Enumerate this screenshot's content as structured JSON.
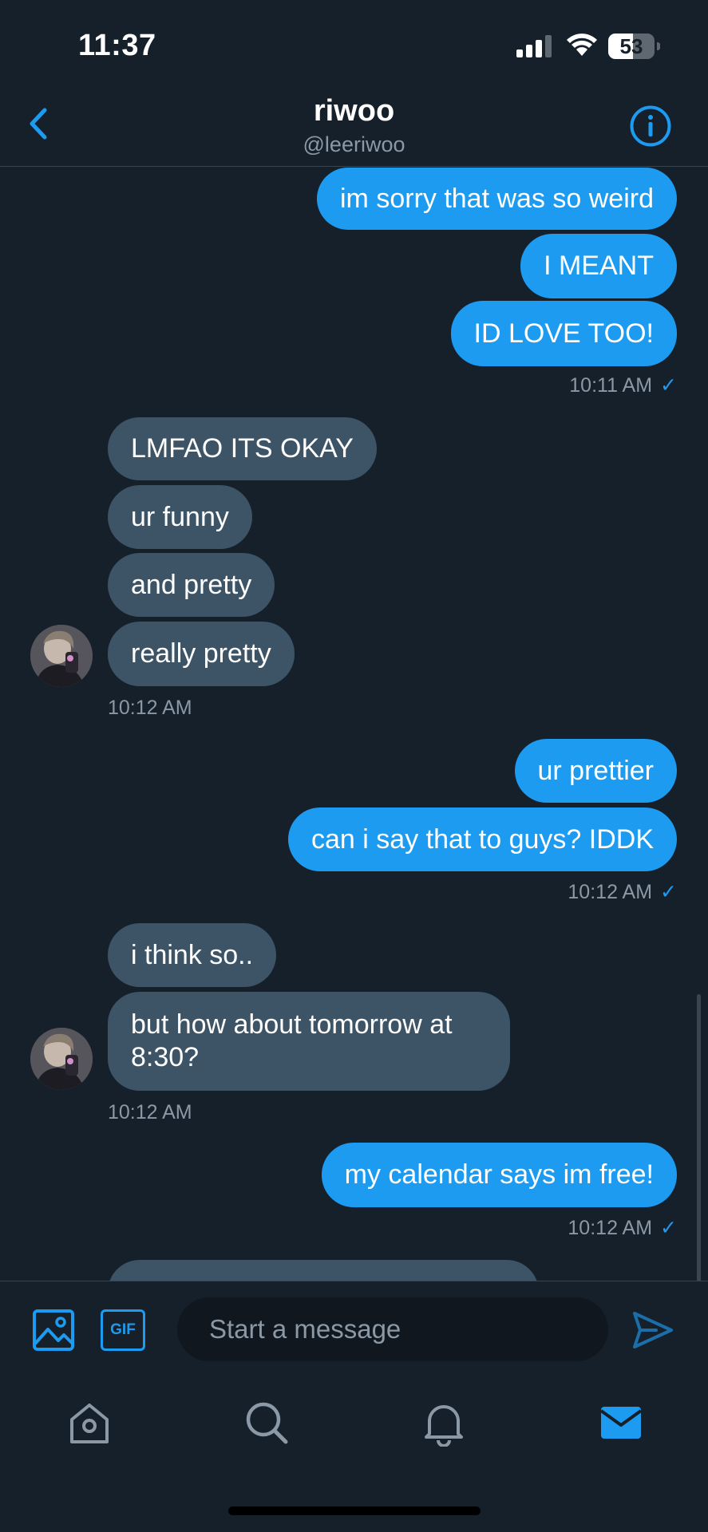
{
  "status_bar": {
    "time": "11:37",
    "battery_percent": "53",
    "battery_level": 0.53,
    "signal_icon": "cellular-signal-icon",
    "wifi_icon": "wifi-icon"
  },
  "header": {
    "name": "riwoo",
    "handle": "@leeriwoo",
    "back_icon": "chevron-left-icon",
    "info_icon": "info-circle-icon"
  },
  "messages": [
    {
      "side": "sent",
      "text": "im sorry that was so weird"
    },
    {
      "side": "sent",
      "text": "I MEANT"
    },
    {
      "side": "sent",
      "text": "ID LOVE TOO!"
    },
    {
      "side": "sent-time",
      "text": "10:11 AM",
      "check": "✓"
    },
    {
      "side": "received",
      "text": "LMFAO ITS OKAY"
    },
    {
      "side": "received",
      "text": "ur funny"
    },
    {
      "side": "received",
      "text": "and pretty"
    },
    {
      "side": "received",
      "text": "really pretty"
    },
    {
      "side": "received-time",
      "text": "10:12 AM"
    },
    {
      "side": "sent",
      "text": "ur prettier"
    },
    {
      "side": "sent",
      "text": "can i say that to guys? IDDK"
    },
    {
      "side": "sent-time",
      "text": "10:12 AM",
      "check": "✓"
    },
    {
      "side": "received",
      "text": "i think so.."
    },
    {
      "side": "received",
      "text": "but how about tomorrow at 8:30?"
    },
    {
      "side": "received-time",
      "text": "10:12 AM"
    },
    {
      "side": "sent",
      "text": "my calendar says im free!"
    },
    {
      "side": "sent-time",
      "text": "10:12 AM",
      "check": "✓"
    }
  ],
  "composer": {
    "placeholder": "Start a message",
    "gif_label": "GIF",
    "media_icon": "image-icon",
    "send_icon": "send-icon"
  },
  "tabs": [
    {
      "name": "home",
      "icon": "home-icon",
      "active": false
    },
    {
      "name": "search",
      "icon": "search-icon",
      "active": false
    },
    {
      "name": "notifications",
      "icon": "bell-icon",
      "active": false
    },
    {
      "name": "messages",
      "icon": "mail-icon",
      "active": true
    }
  ],
  "colors": {
    "background": "#15202b",
    "accent": "#1d9bf0",
    "received_bubble": "#3d5466",
    "secondary_text": "#8b98a5",
    "divider": "#38444d",
    "inactive_icon": "#8b98a5"
  }
}
